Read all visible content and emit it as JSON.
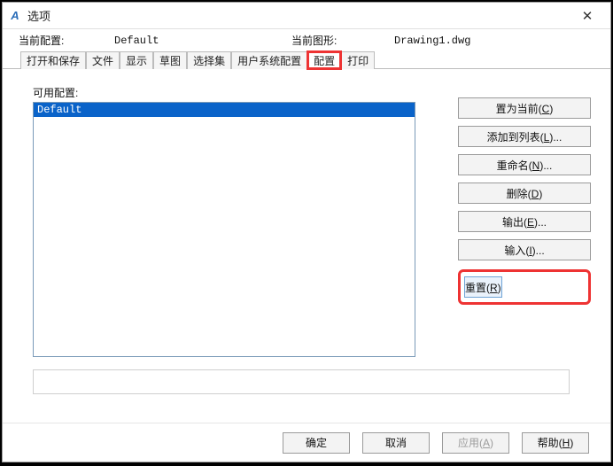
{
  "window": {
    "title": "选项",
    "close_glyph": "✕"
  },
  "info": {
    "current_profile_label": "当前配置:",
    "current_profile_value": "Default",
    "current_drawing_label": "当前图形:",
    "current_drawing_value": "Drawing1.dwg"
  },
  "tabs": {
    "items": [
      {
        "label": "打开和保存",
        "active": false
      },
      {
        "label": "文件",
        "active": false
      },
      {
        "label": "显示",
        "active": false
      },
      {
        "label": "草图",
        "active": false
      },
      {
        "label": "选择集",
        "active": false
      },
      {
        "label": "用户系统配置",
        "active": false
      },
      {
        "label": "配置",
        "active": true,
        "highlight": true
      },
      {
        "label": "打印",
        "active": false
      }
    ]
  },
  "profiles": {
    "available_label": "可用配置:",
    "list": [
      {
        "name": "Default",
        "selected": true
      }
    ],
    "buttons": {
      "set_current": "置为当前(C)",
      "add_to_list": "添加到列表(L)...",
      "rename": "重命名(N)...",
      "delete": "删除(D)",
      "export": "输出(E)...",
      "import": "输入(I)...",
      "reset": "重置(R)"
    }
  },
  "footer": {
    "ok": "确定",
    "cancel": "取消",
    "apply": "应用(A)",
    "help": "帮助(H)"
  }
}
